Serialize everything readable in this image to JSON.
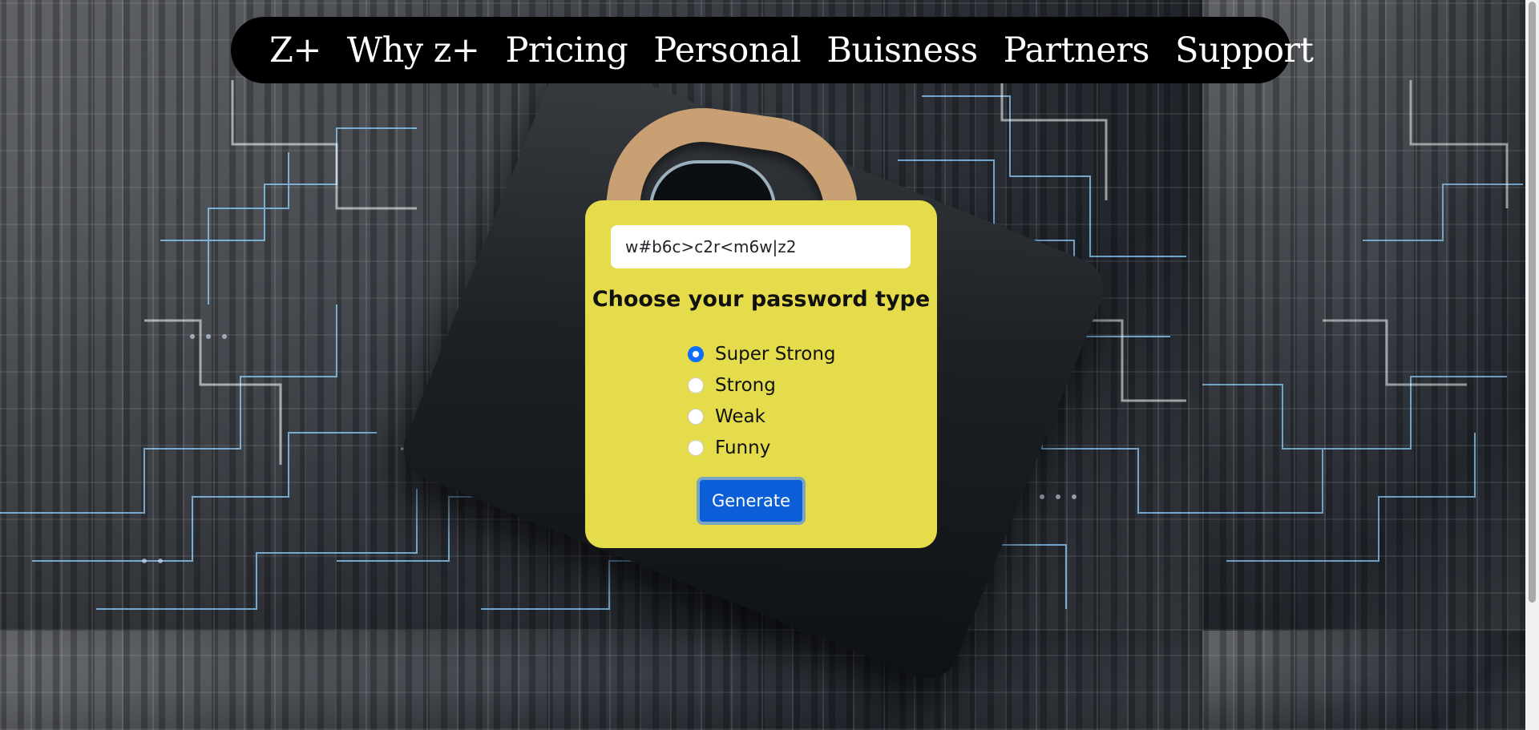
{
  "nav": {
    "items": [
      "Z+",
      "Why z+",
      "Pricing",
      "Personal",
      "Buisness",
      "Partners",
      "Support"
    ]
  },
  "generator": {
    "password_value": "w#b6c>c2r<m6w|z2",
    "title": "Choose your password type",
    "options": [
      {
        "label": "Super Strong",
        "checked": true
      },
      {
        "label": "Strong",
        "checked": false
      },
      {
        "label": "Weak",
        "checked": false
      },
      {
        "label": "Funny",
        "checked": false
      }
    ],
    "generate_label": "Generate"
  },
  "colors": {
    "card": "#e4dc4a",
    "button": "#0b5ed7",
    "nav": "#000000"
  },
  "background": {
    "icon": "padlock-circuit-board-image"
  }
}
